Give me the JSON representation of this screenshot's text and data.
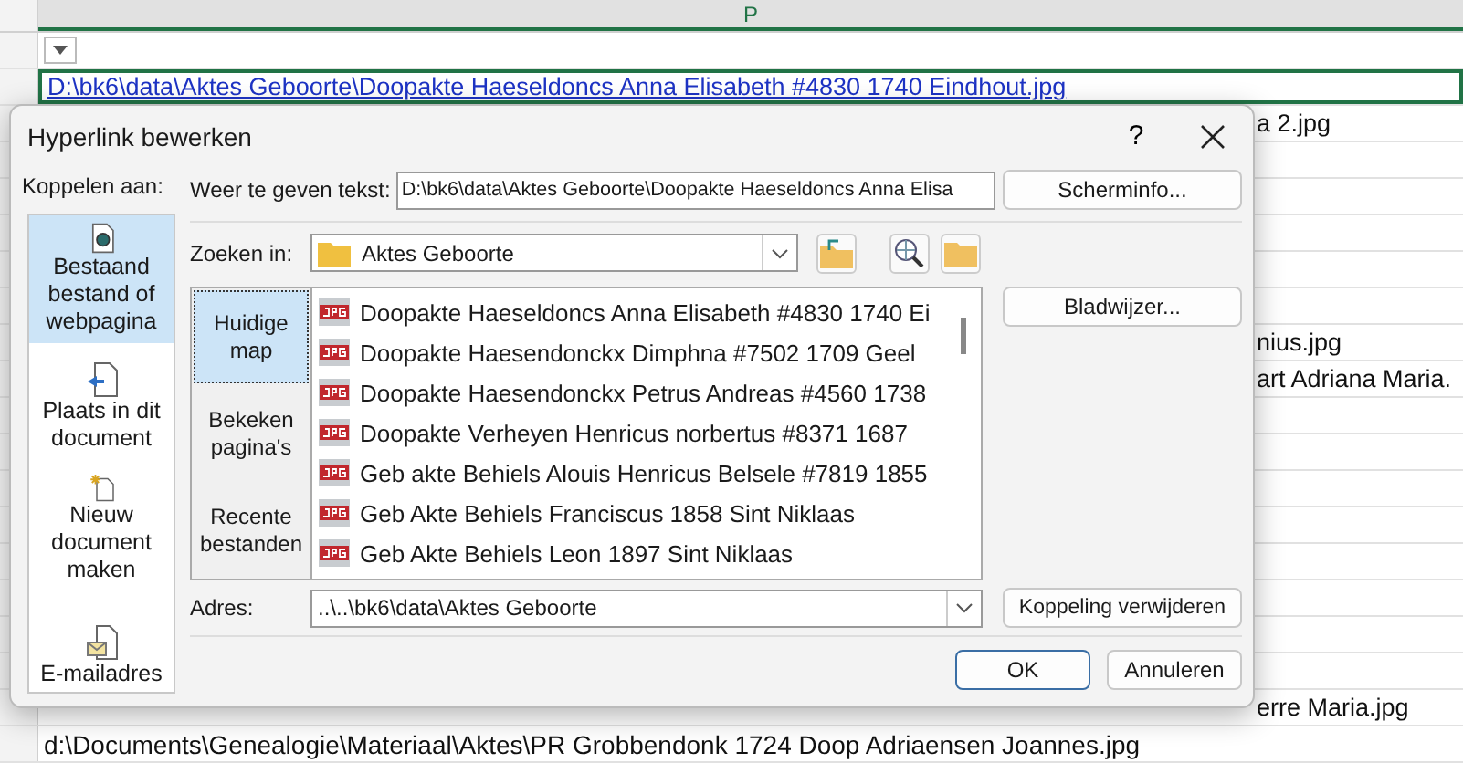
{
  "sheet": {
    "column_header": "P",
    "rows": [
      {
        "kind": "filter",
        "selected": false
      },
      {
        "kind": "link",
        "text": "D:\\bk6\\data\\Aktes Geboorte\\Doopakte Haeseldoncs Anna Elisabeth #4830 1740 Eindhout.jpg",
        "selected": true
      },
      {
        "kind": "tail",
        "text": "a 2.jpg",
        "selected": false
      },
      {
        "kind": "empty",
        "selected": false
      },
      {
        "kind": "empty",
        "selected": false
      },
      {
        "kind": "empty",
        "selected": false
      },
      {
        "kind": "empty",
        "selected": false
      },
      {
        "kind": "empty",
        "selected": false
      },
      {
        "kind": "tail",
        "text": "nius.jpg",
        "selected": false
      },
      {
        "kind": "tail",
        "text": "art Adriana Maria.",
        "selected": false
      },
      {
        "kind": "empty",
        "selected": false
      },
      {
        "kind": "empty",
        "selected": false
      },
      {
        "kind": "empty",
        "selected": false
      },
      {
        "kind": "empty",
        "selected": false
      },
      {
        "kind": "empty",
        "selected": false
      },
      {
        "kind": "empty",
        "selected": false
      },
      {
        "kind": "empty",
        "selected": false
      },
      {
        "kind": "empty",
        "selected": false
      },
      {
        "kind": "tail",
        "text": "erre Maria.jpg",
        "selected": false
      },
      {
        "kind": "text",
        "text": "d:\\Documents\\Genealogie\\Materiaal\\Aktes\\PR Grobbendonk 1724 Doop Adriaensen Joannes.jpg",
        "selected": false
      }
    ]
  },
  "dialog": {
    "title": "Hyperlink bewerken",
    "help": "?",
    "link_to": {
      "label": "Koppelen aan:",
      "items": [
        {
          "kind": "file",
          "label": "Bestaand bestand of webpagina",
          "selected": true
        },
        {
          "kind": "place",
          "label": "Plaats in dit document",
          "selected": false
        },
        {
          "kind": "new",
          "label": "Nieuw document maken",
          "selected": false
        },
        {
          "kind": "email",
          "label": "E-mailadres",
          "selected": false
        }
      ]
    },
    "display_text": {
      "label": "Weer te geven tekst:",
      "value": "D:\\bk6\\data\\Aktes Geboorte\\Doopakte Haeseldoncs Anna Elisa"
    },
    "screen_tip_button": "Scherminfo...",
    "look_in": {
      "label": "Zoeken in:",
      "value": "Aktes Geboorte"
    },
    "views": [
      {
        "label": "Huidige map",
        "selected": true
      },
      {
        "label": "Bekeken pagina's",
        "selected": false
      },
      {
        "label": "Recente bestanden",
        "selected": false
      }
    ],
    "files": [
      "Doopakte Haeseldoncs Anna Elisabeth #4830 1740 Ei",
      "Doopakte Haesendonckx Dimphna #7502 1709 Geel",
      "Doopakte Haesendonckx Petrus Andreas #4560 1738",
      "Doopakte Verheyen Henricus norbertus #8371 1687",
      "Geb akte Behiels Alouis Henricus Belsele #7819 1855",
      "Geb Akte Behiels Franciscus 1858 Sint Niklaas",
      "Geb Akte Behiels Leon 1897 Sint Niklaas"
    ],
    "bookmark_button": "Bladwijzer...",
    "address": {
      "label": "Adres:",
      "value": "..\\..\\bk6\\data\\Aktes Geboorte"
    },
    "remove_link_button": "Koppeling verwijderen",
    "buttons": [
      "OK",
      "Annuleren"
    ]
  }
}
